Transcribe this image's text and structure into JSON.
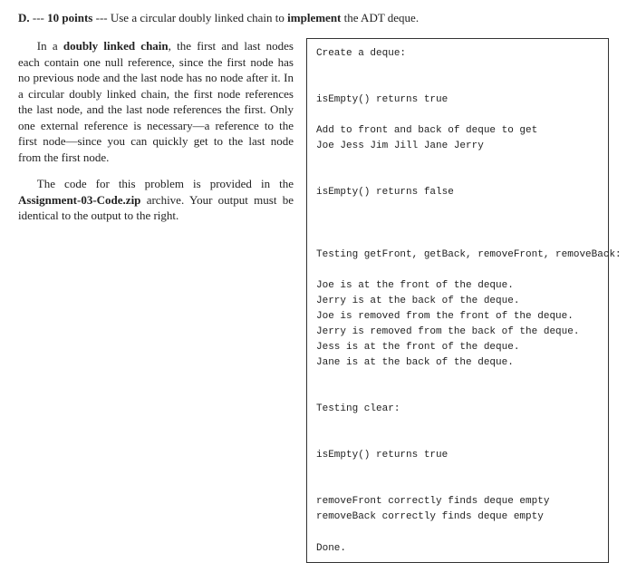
{
  "header": {
    "label": "D.",
    "points_prefix": " --- ",
    "points": "10 points",
    "points_suffix": " --- ",
    "text_before": "Use a circular doubly linked chain to ",
    "bold_word": "implement",
    "text_after": " the ADT deque."
  },
  "para1": {
    "lead": "In a ",
    "bold": "doubly linked chain",
    "rest": ", the first and last nodes each contain one null reference, since the first node has no previous node and the last node has no node after it. In a circular doubly linked chain, the first node references the last node, and the last node references the first. Only one external reference is necessary—a reference to the first node—since you can quickly get to the last node from the first node."
  },
  "para2": {
    "lead": "The code for this problem is provided in the ",
    "bold": "Assignment-03-Code.zip",
    "rest": " archive. Your output must be identical to the output to the right."
  },
  "output": {
    "lines": [
      "Create a deque:",
      "",
      "",
      "isEmpty() returns true",
      "",
      "Add to front and back of deque to get",
      "Joe Jess Jim Jill Jane Jerry",
      "",
      "",
      "isEmpty() returns false",
      "",
      "",
      "",
      "Testing getFront, getBack, removeFront, removeBack:",
      "",
      "Joe is at the front of the deque.",
      "Jerry is at the back of the deque.",
      "Joe is removed from the front of the deque.",
      "Jerry is removed from the back of the deque.",
      "Jess is at the front of the deque.",
      "Jane is at the back of the deque.",
      "",
      "",
      "Testing clear:",
      "",
      "",
      "isEmpty() returns true",
      "",
      "",
      "removeFront correctly finds deque empty",
      "removeBack correctly finds deque empty",
      "",
      "Done."
    ]
  }
}
